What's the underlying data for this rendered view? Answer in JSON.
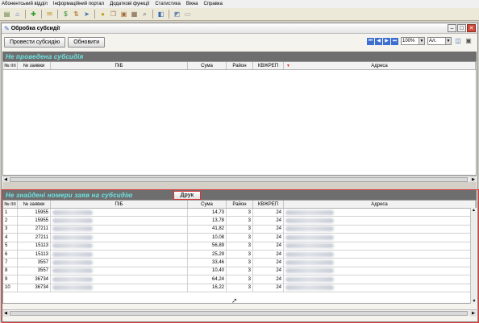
{
  "menu": [
    "Абонентський відділ",
    "Інформаційний портал",
    "Додаткові функції",
    "Статистика",
    "Вікна",
    "Справка"
  ],
  "toolbar_icons": [
    "export-icon",
    "home-icon",
    "add-icon",
    "mail-icon",
    "money-icon",
    "sort-icon",
    "run-icon",
    "coin-icon",
    "copy-icon",
    "print-icon",
    "preview-icon",
    "search-icon",
    "info-icon",
    "chat-icon",
    "exit-icon"
  ],
  "window": {
    "title": "Обробка субсидії"
  },
  "buttons": {
    "process": "Провести субсидію",
    "refresh": "Обновити"
  },
  "nav": {
    "zoom": "100%",
    "format": "Ал."
  },
  "top_panel": {
    "title": "Не проведена субсидія",
    "columns": [
      "№ пп",
      "№ заявки",
      "ПІБ",
      "Сума",
      "Район",
      "КВЖРЕП",
      "Адреса"
    ]
  },
  "bottom_panel": {
    "title": "Не знайдені номери заяв на субсидію",
    "print": "Друк",
    "columns": [
      "№ пп",
      "№ заявки",
      "ПІБ",
      "Сума",
      "Район",
      "КВЖРЕП",
      "Адреса"
    ],
    "rows": [
      {
        "n": "1",
        "app": "15955",
        "sum": "14,73",
        "district": "3",
        "kv": "24"
      },
      {
        "n": "2",
        "app": "15955",
        "sum": "13,78",
        "district": "3",
        "kv": "24"
      },
      {
        "n": "3",
        "app": "27211",
        "sum": "41,82",
        "district": "3",
        "kv": "24"
      },
      {
        "n": "4",
        "app": "27211",
        "sum": "10,08",
        "district": "3",
        "kv": "24"
      },
      {
        "n": "5",
        "app": "15113",
        "sum": "56,89",
        "district": "3",
        "kv": "24"
      },
      {
        "n": "6",
        "app": "15113",
        "sum": "25,29",
        "district": "3",
        "kv": "24"
      },
      {
        "n": "7",
        "app": "3557",
        "sum": "33,46",
        "district": "3",
        "kv": "24"
      },
      {
        "n": "8",
        "app": "3557",
        "sum": "10,40",
        "district": "3",
        "kv": "24"
      },
      {
        "n": "9",
        "app": "36734",
        "sum": "64,24",
        "district": "3",
        "kv": "24"
      },
      {
        "n": "10",
        "app": "36734",
        "sum": "16,22",
        "district": "3",
        "kv": "24"
      }
    ]
  }
}
